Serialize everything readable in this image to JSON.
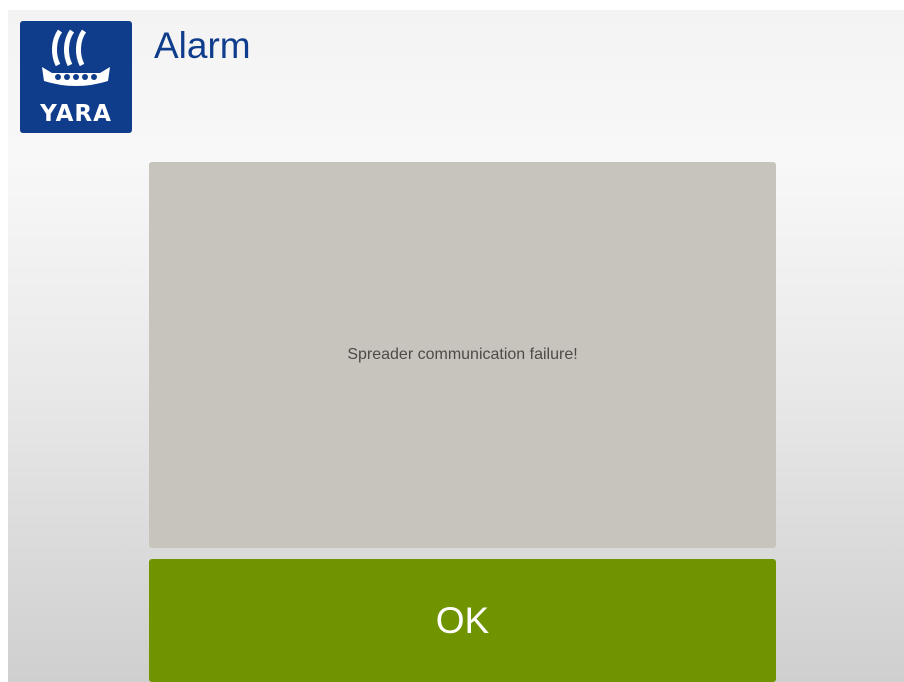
{
  "header": {
    "logo_text": "YARA",
    "title": "Alarm"
  },
  "alarm": {
    "message": "Spreader communication failure!"
  },
  "actions": {
    "ok_label": "OK"
  },
  "colors": {
    "brand_blue": "#0f3d8c",
    "panel_gray": "#c7c3bd",
    "ok_green": "#6f9400"
  }
}
